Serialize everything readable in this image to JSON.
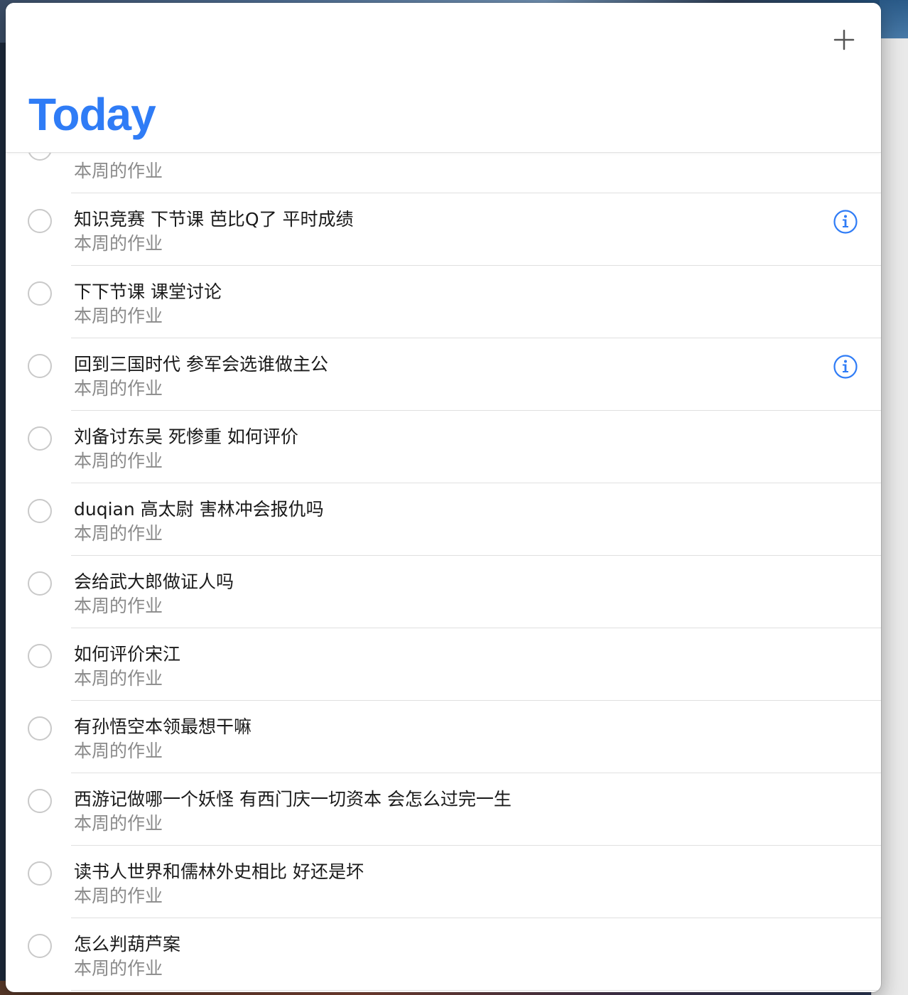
{
  "header": {
    "title": "Today",
    "add_icon": "plus-icon"
  },
  "colors": {
    "accent": "#2f7cf6",
    "subtitle": "#8a8a8a",
    "circle": "#c9c9c9"
  },
  "list": {
    "subtitle": "本周的作业",
    "items": [
      {
        "title": "",
        "subtitle": "本周的作业",
        "has_info": false
      },
      {
        "title": "知识竞赛 下节课 芭比Q了 平时成绩",
        "subtitle": "本周的作业",
        "has_info": true
      },
      {
        "title": "下下节课 课堂讨论",
        "subtitle": "本周的作业",
        "has_info": false
      },
      {
        "title": "回到三国时代 参军会选谁做主公",
        "subtitle": "本周的作业",
        "has_info": true
      },
      {
        "title": "刘备讨东吴 死惨重 如何评价",
        "subtitle": "本周的作业",
        "has_info": false
      },
      {
        "title": "duqian 高太尉 害林冲会报仇吗",
        "subtitle": "本周的作业",
        "has_info": false
      },
      {
        "title": "会给武大郎做证人吗",
        "subtitle": "本周的作业",
        "has_info": false
      },
      {
        "title": "如何评价宋江",
        "subtitle": "本周的作业",
        "has_info": false
      },
      {
        "title": "有孙悟空本领最想干嘛",
        "subtitle": "本周的作业",
        "has_info": false
      },
      {
        "title": "西游记做哪一个妖怪 有西门庆一切资本 会怎么过完一生",
        "subtitle": "本周的作业",
        "has_info": false
      },
      {
        "title": "读书人世界和儒林外史相比 好还是坏",
        "subtitle": "本周的作业",
        "has_info": false
      },
      {
        "title": "怎么判葫芦案",
        "subtitle": "本周的作业",
        "has_info": false
      }
    ]
  }
}
